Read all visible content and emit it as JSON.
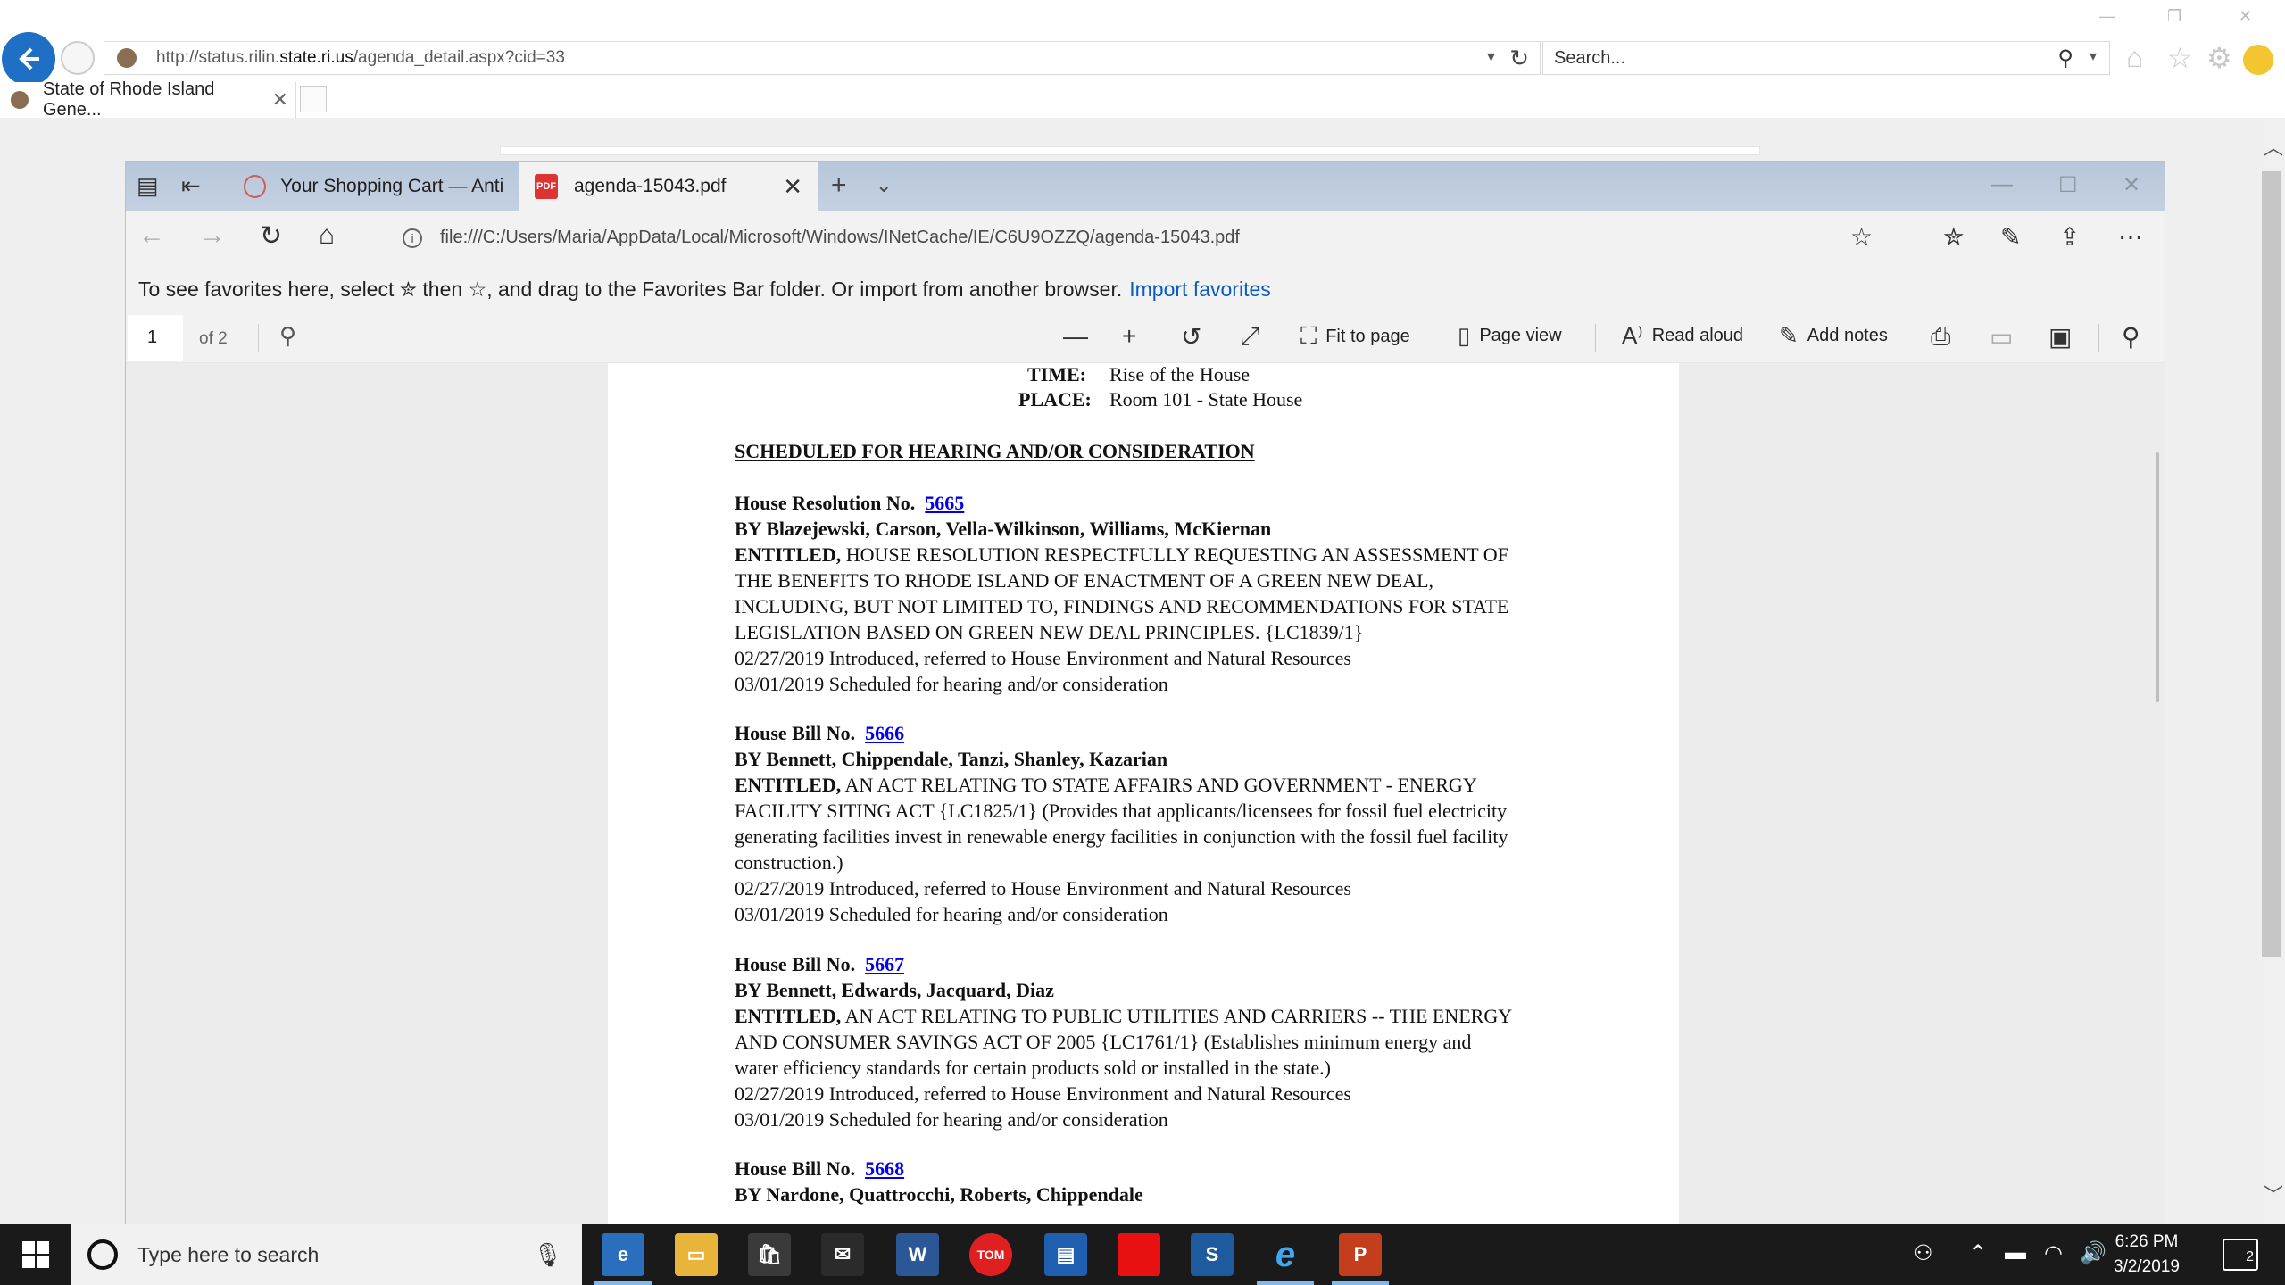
{
  "ie": {
    "url_prefix": "http://status.rilin.",
    "url_domain": "state.ri.us",
    "url_suffix": "/agenda_detail.aspx?cid=33",
    "search_placeholder": "Search...",
    "tab_title": "State of Rhode Island Gene..."
  },
  "edge": {
    "tabs": [
      {
        "title": "Your Shopping Cart — Antic"
      },
      {
        "title": "agenda-15043.pdf"
      }
    ],
    "address": "file:///C:/Users/Maria/AppData/Local/Microsoft/Windows/INetCache/IE/C6U9OZZQ/agenda-15043.pdf",
    "favorites_bar": {
      "text": "To see favorites here, select ✮ then ☆, and drag to the Favorites Bar folder. Or import from another browser.",
      "link": "Import favorites"
    }
  },
  "pdf_toolbar": {
    "page": "1",
    "of": "of 2",
    "fit_to_page": "Fit to page",
    "page_view": "Page view",
    "read_aloud": "Read aloud",
    "add_notes": "Add notes"
  },
  "document": {
    "time_label": "TIME:",
    "time_value": "Rise of the House",
    "place_label": "PLACE:",
    "place_value": "Room 101 - State House",
    "heading": "SCHEDULED FOR HEARING AND/OR CONSIDERATION",
    "entries": [
      {
        "type": "House Resolution No.",
        "number": "5665",
        "by": "BY  Blazejewski, Carson, Vella-Wilkinson, Williams, McKiernan",
        "entitled_label": "ENTITLED,",
        "entitled": [
          "HOUSE RESOLUTION RESPECTFULLY REQUESTING AN ASSESSMENT OF",
          "THE BENEFITS TO RHODE ISLAND OF ENACTMENT OF A GREEN NEW DEAL,",
          "INCLUDING, BUT NOT LIMITED TO, FINDINGS AND RECOMMENDATIONS FOR STATE",
          "LEGISLATION BASED ON GREEN NEW DEAL PRINCIPLES. {LC1839/1}"
        ],
        "history": [
          "02/27/2019 Introduced, referred to House Environment and Natural Resources",
          "03/01/2019 Scheduled for hearing and/or consideration"
        ]
      },
      {
        "type": "House Bill No.",
        "number": "5666",
        "by": "BY  Bennett, Chippendale, Tanzi, Shanley, Kazarian",
        "entitled_label": "ENTITLED,",
        "entitled": [
          "AN ACT RELATING TO STATE AFFAIRS AND GOVERNMENT - ENERGY",
          "FACILITY SITING ACT {LC1825/1} (Provides that applicants/licensees for fossil fuel electricity",
          "generating facilities invest in renewable energy facilities in conjunction with the fossil fuel facility",
          "construction.)"
        ],
        "history": [
          "02/27/2019 Introduced, referred to House Environment and Natural Resources",
          "03/01/2019 Scheduled for hearing and/or consideration"
        ]
      },
      {
        "type": "House Bill No.",
        "number": "5667",
        "by": "BY  Bennett, Edwards, Jacquard, Diaz",
        "entitled_label": "ENTITLED,",
        "entitled": [
          "AN ACT RELATING TO PUBLIC UTILITIES AND CARRIERS -- THE ENERGY",
          "AND CONSUMER SAVINGS ACT OF 2005 {LC1761/1} (Establishes minimum energy and",
          "water efficiency standards for certain products sold or installed in the state.)"
        ],
        "history": [
          "02/27/2019 Introduced, referred to House Environment and Natural Resources",
          "03/01/2019 Scheduled for hearing and/or consideration"
        ]
      },
      {
        "type": "House Bill No.",
        "number": "5668",
        "by": "BY  Nardone, Quattrocchi, Roberts, Chippendale"
      }
    ]
  },
  "taskbar": {
    "search_placeholder": "Type here to search",
    "time": "6:26 PM",
    "date": "3/2/2019",
    "notifications": "2",
    "word_label": "W",
    "ppt_label": "P"
  },
  "colors": {
    "ie_back": "#1f6fc4",
    "link": "#0000ee",
    "favorites_link": "#0a5bc4",
    "taskbar": "#1a1a1a"
  }
}
